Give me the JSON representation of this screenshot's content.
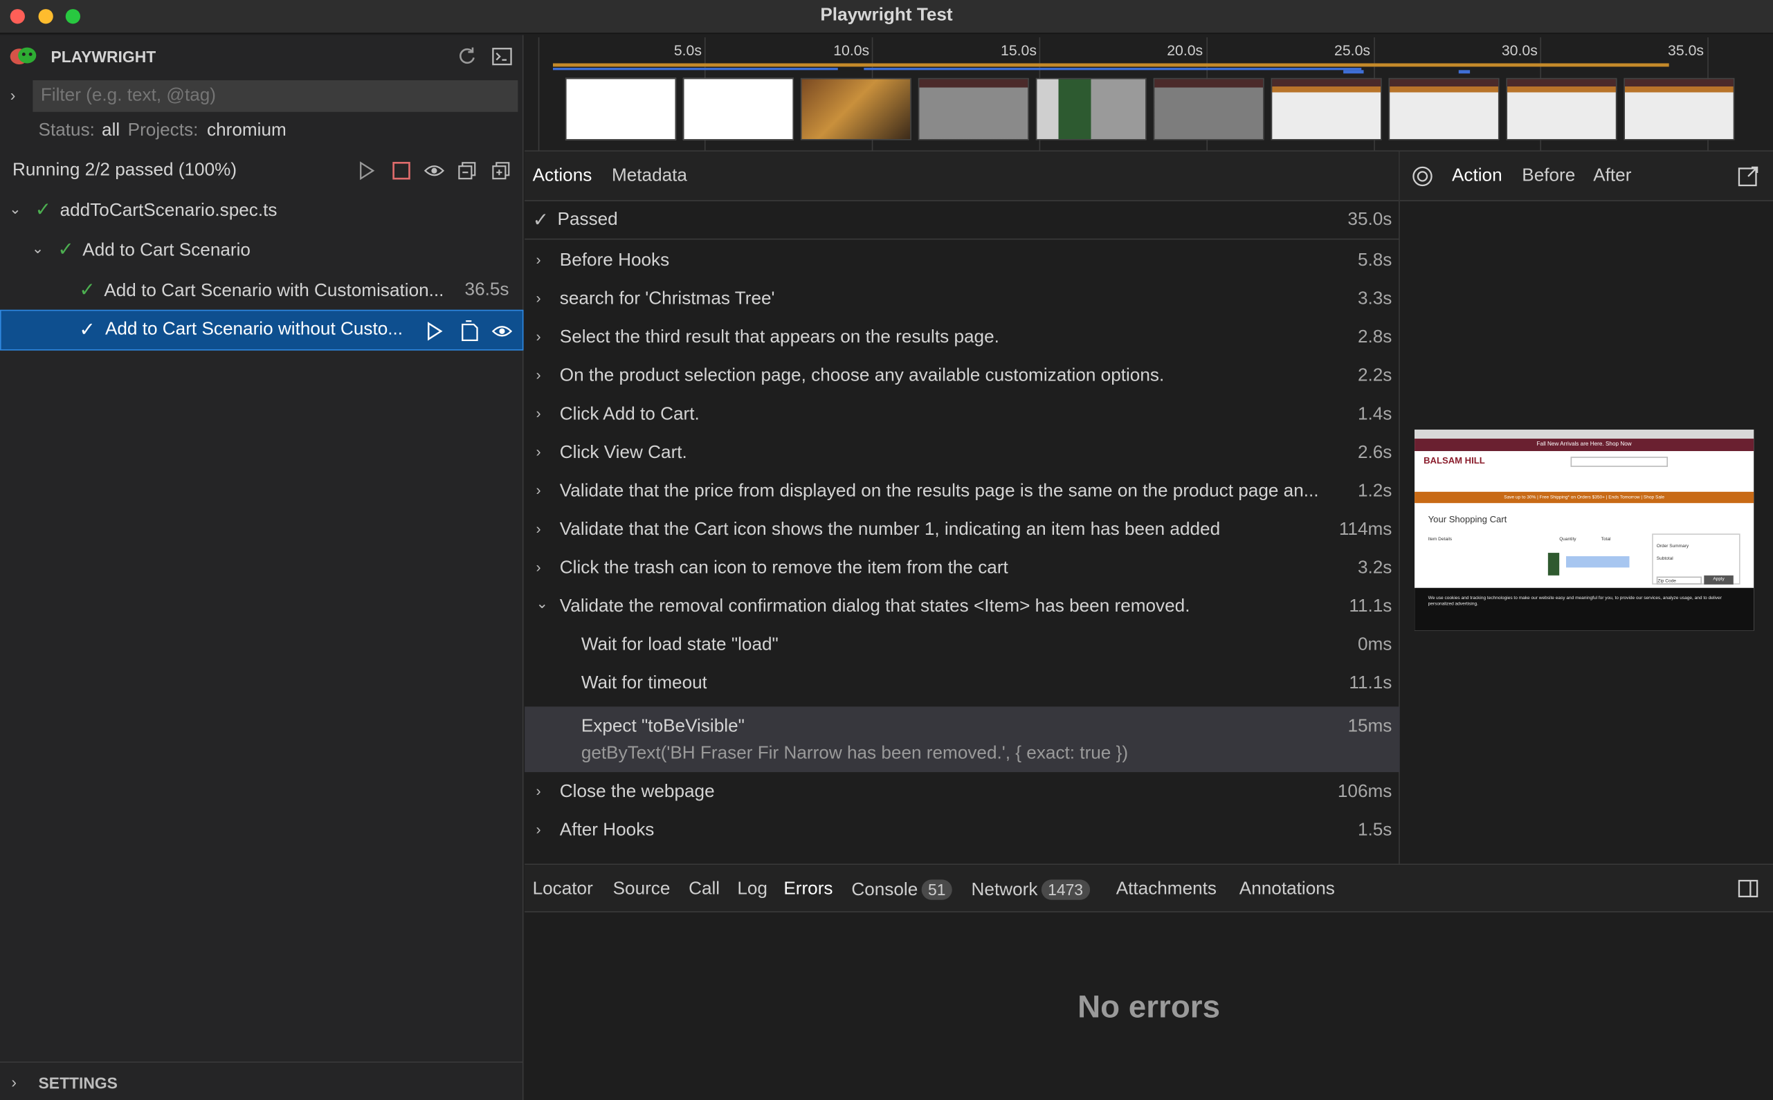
{
  "window": {
    "title": "Playwright Test"
  },
  "sidebar": {
    "brand": "PLAYWRIGHT",
    "filter_placeholder": "Filter (e.g. text, @tag)",
    "status_label": "Status:",
    "status_value": "all",
    "projects_label": "Projects:",
    "projects_value": "chromium",
    "running_text": "Running 2/2 passed (100%)",
    "tree": {
      "file": "addToCartScenario.spec.ts",
      "suite": "Add to Cart Scenario",
      "tests": [
        {
          "label": "Add to Cart Scenario with Customisation...",
          "duration": "36.5s"
        },
        {
          "label": "Add to Cart Scenario without Custo...",
          "duration": ""
        }
      ]
    },
    "settings_label": "SETTINGS"
  },
  "timeline": {
    "ticks": [
      "5.0s",
      "10.0s",
      "15.0s",
      "20.0s",
      "25.0s",
      "30.0s",
      "35.0s"
    ]
  },
  "actions_panel": {
    "tabs": [
      "Actions",
      "Metadata"
    ],
    "passed_label": "Passed",
    "passed_duration": "35.0s",
    "rows": [
      {
        "label": "Before Hooks",
        "duration": "5.8s"
      },
      {
        "label": "search for 'Christmas Tree'",
        "duration": "3.3s"
      },
      {
        "label": "Select the third result that appears on the results page.",
        "duration": "2.8s"
      },
      {
        "label": "On the product selection page, choose any available customization options.",
        "duration": "2.2s"
      },
      {
        "label": "Click Add to Cart.",
        "duration": "1.4s"
      },
      {
        "label": "Click View Cart.",
        "duration": "2.6s"
      },
      {
        "label": "Validate that the price from displayed on the results page is the same on the product page an...",
        "duration": "1.2s"
      },
      {
        "label": "Validate that the Cart icon shows the number 1, indicating an item has been added",
        "duration": "114ms"
      },
      {
        "label": "Click the trash can icon to remove the item from the cart",
        "duration": "3.2s"
      },
      {
        "label": "Validate the removal confirmation dialog that states <Item> has been removed.",
        "duration": "11.1s"
      }
    ],
    "sub_rows": [
      {
        "label": "Wait for load state \"load\"",
        "duration": "0ms"
      },
      {
        "label": "Wait for timeout",
        "duration": "11.1s"
      },
      {
        "label": "Expect \"toBeVisible\"",
        "duration": "15ms",
        "detail": "getByText('BH Fraser Fir Narrow has been removed.', { exact: true })"
      }
    ],
    "tail_rows": [
      {
        "label": "Close the webpage",
        "duration": "106ms"
      },
      {
        "label": "After Hooks",
        "duration": "1.5s"
      }
    ]
  },
  "preview_panel": {
    "tabs": [
      "Action",
      "Before",
      "After"
    ],
    "snapshot": {
      "banner": "Fall New Arrivals are Here. Shop Now",
      "brand": "BALSAM HILL",
      "heading": "Your Shopping Cart",
      "promo": "Save up to 30% | Free Shipping* on Orders $350+ | Ends Tomorrow | Shop Sale",
      "cookie": "We use cookies and tracking technologies to make our website easy and meaningful for you, to provide our services, analyze usage, and to deliver personalized advertising.",
      "col_item": "Item Details",
      "col_qty": "Quantity",
      "col_total": "Total",
      "summary": "Order Summary",
      "subtotal": "Subtotal",
      "apply": "Apply",
      "zip": "Zip Code"
    }
  },
  "bottom_panel": {
    "tabs": [
      {
        "label": "Locator"
      },
      {
        "label": "Source"
      },
      {
        "label": "Call"
      },
      {
        "label": "Log"
      },
      {
        "label": "Errors"
      },
      {
        "label": "Console",
        "count": "51"
      },
      {
        "label": "Network",
        "count": "1473"
      },
      {
        "label": "Attachments"
      },
      {
        "label": "Annotations"
      }
    ],
    "empty_text": "No errors"
  },
  "colors": {
    "accent": "#0e4f8f",
    "pass": "#4caf50",
    "stop": "#e06c6c"
  }
}
